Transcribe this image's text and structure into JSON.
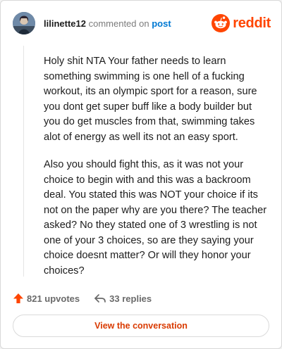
{
  "header": {
    "username": "lilinette12",
    "commented_on": "commented on",
    "post_link": "post",
    "brand": "reddit",
    "avatar_icon": "user-avatar",
    "brand_icon": "reddit-snoo-icon"
  },
  "comment": {
    "paragraphs": [
      "Holy shit NTA Your father needs to learn something swimming is one hell of a fucking workout, its an olympic sport for a reason, sure you dont get super buff like a body builder but you do get muscles from that, swimming takes alot of energy as well its not an easy sport.",
      "Also you should fight this, as it was not your choice to begin with and this was a backroom deal. You stated this was NOT your choice if its not on the paper why are you there? The teacher asked? No they stated one of 3 wrestling is not one of your 3 choices, so are they saying your choice doesnt matter? Or will they honor your choices?"
    ]
  },
  "actions": {
    "upvotes": "821 upvotes",
    "replies": "33 replies",
    "upvote_icon": "upvote-arrow-icon",
    "reply_icon": "reply-arrow-icon"
  },
  "cta": {
    "label": "View the conversation"
  },
  "colors": {
    "accent": "#ff4500",
    "link": "#0079d3",
    "cta_text": "#d93a00"
  }
}
